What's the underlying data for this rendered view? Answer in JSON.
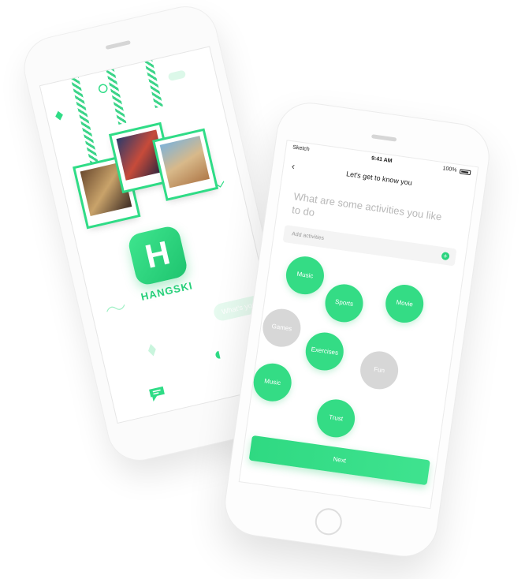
{
  "splash": {
    "brand_name": "HANGSKI",
    "logo_letter": "H",
    "chat_preview": "What's your plan?"
  },
  "onboarding": {
    "status_bar": {
      "carrier": "Sketch",
      "time": "9:41 AM",
      "battery": "100%"
    },
    "title": "Let's get to know you",
    "question": "What are some activities you like to do",
    "add_field_placeholder": "Add activities",
    "activities": [
      {
        "label": "Music",
        "selected": true
      },
      {
        "label": "Sports",
        "selected": true
      },
      {
        "label": "Movie",
        "selected": true
      },
      {
        "label": "Games",
        "selected": false
      },
      {
        "label": "Exercises",
        "selected": true
      },
      {
        "label": "Fun",
        "selected": false
      },
      {
        "label": "Music",
        "selected": true
      },
      {
        "label": "Trust",
        "selected": true
      }
    ],
    "next_label": "Next"
  },
  "colors": {
    "accent": "#2fdc86",
    "inactive": "#d7d7d7"
  }
}
